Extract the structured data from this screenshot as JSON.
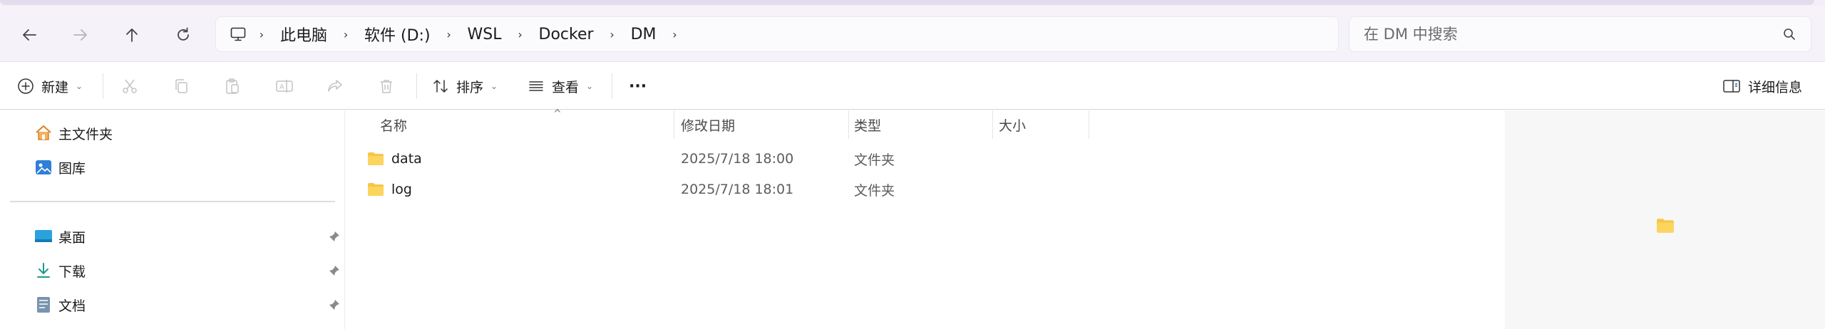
{
  "nav": {
    "back_label": "back",
    "forward_label": "forward",
    "up_label": "up",
    "refresh_label": "refresh"
  },
  "address": {
    "icon": "computer-icon",
    "crumbs": [
      "此电脑",
      "软件 (D:)",
      "WSL",
      "Docker",
      "DM"
    ]
  },
  "search": {
    "placeholder": "在 DM 中搜索",
    "value": ""
  },
  "toolbar": {
    "new_label": "新建",
    "sort_label": "排序",
    "view_label": "查看",
    "more_label": "···",
    "details_label": "详细信息"
  },
  "sidebar": {
    "items": [
      {
        "label": "主文件夹",
        "icon": "home-icon"
      },
      {
        "label": "图库",
        "icon": "gallery-icon"
      }
    ],
    "pinned": [
      {
        "label": "桌面",
        "icon": "desktop-icon"
      },
      {
        "label": "下载",
        "icon": "download-icon"
      },
      {
        "label": "文档",
        "icon": "documents-icon"
      }
    ]
  },
  "columns": {
    "name": "名称",
    "date": "修改日期",
    "type": "类型",
    "size": "大小"
  },
  "files": [
    {
      "name": "data",
      "date": "2025/7/18 18:00",
      "type": "文件夹",
      "size": ""
    },
    {
      "name": "log",
      "date": "2025/7/18 18:01",
      "type": "文件夹",
      "size": ""
    }
  ],
  "colors": {
    "folder": "#f6c646",
    "accent": "#0067c0",
    "nav_bg": "#f5f2f9"
  }
}
